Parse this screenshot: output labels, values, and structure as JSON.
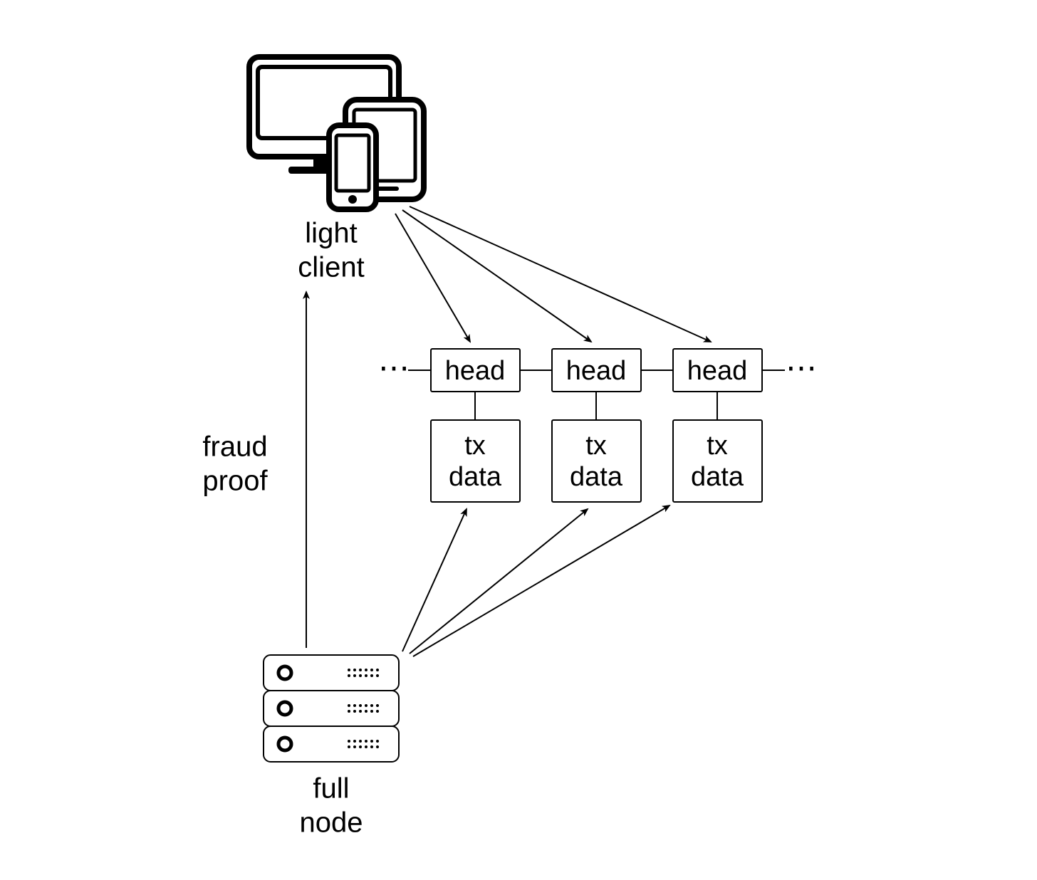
{
  "light_client": {
    "line1": "light",
    "line2": "client"
  },
  "full_node": {
    "line1": "full",
    "line2": "node"
  },
  "fraud_proof": {
    "line1": "fraud",
    "line2": "proof"
  },
  "blocks": {
    "ellipsis_left": "⋯",
    "ellipsis_right": "⋯",
    "head1": "head",
    "head2": "head",
    "head3": "head",
    "tx1_l1": "tx",
    "tx1_l2": "data",
    "tx2_l1": "tx",
    "tx2_l2": "data",
    "tx3_l1": "tx",
    "tx3_l2": "data"
  }
}
